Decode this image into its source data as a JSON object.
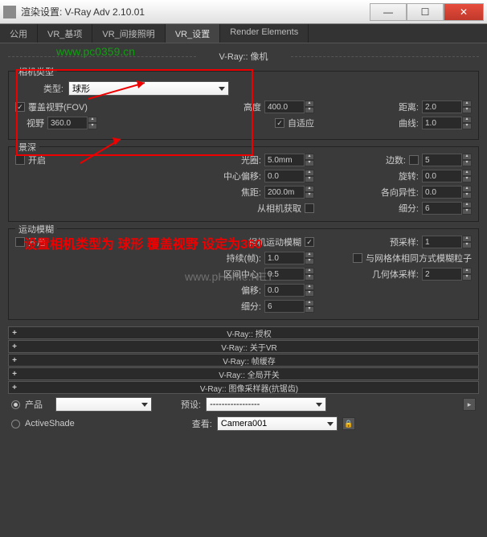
{
  "title": "渲染设置: V-Ray Adv 2.10.01",
  "tabs": [
    "公用",
    "VR_基项",
    "VR_间接照明",
    "VR_设置",
    "Render Elements"
  ],
  "mainSection": "V-Ray:: 像机",
  "cameraType": {
    "legend": "相机类型",
    "typeLabel": "类型:",
    "typeValue": "球形",
    "overrideFov": "覆盖视野(FOV)",
    "overrideFovChecked": "✓",
    "fovLabel": "视野",
    "fovValue": "360.0",
    "heightLabel": "高度",
    "heightValue": "400.0",
    "adaptiveLabel": "自适应",
    "adaptiveChecked": "✓",
    "distLabel": "距离:",
    "distValue": "2.0",
    "curveLabel": "曲线:",
    "curveValue": "1.0"
  },
  "dof": {
    "legend": "景深",
    "enable": "开启",
    "apertureLabel": "光圈:",
    "apertureValue": "5.0mm",
    "bladesLabel": "边数:",
    "bladesValue": "5",
    "centerBiasLabel": "中心偏移:",
    "centerBiasValue": "0.0",
    "rotLabel": "旋转:",
    "rotValue": "0.0",
    "focalLabel": "焦距:",
    "focalValue": "200.0m",
    "anisLabel": "各向异性:",
    "anisValue": "0.0",
    "fromCamLabel": "从相机获取",
    "subdivLabel": "细分:",
    "subdivValue": "6"
  },
  "motion": {
    "legend": "运动模糊",
    "enable": "开启",
    "camBlurLabel": "相机运动模糊",
    "camBlurChecked": "✓",
    "presampLabel": "预采样:",
    "presampValue": "1",
    "durationLabel": "持续(帧):",
    "durationValue": "1.0",
    "meshLabel": "与网格体相同方式模糊粒子",
    "intervalLabel": "区间中心:",
    "intervalValue": "0.5",
    "geoSampLabel": "几何体采样:",
    "geoSampValue": "2",
    "biasLabel": "偏移:",
    "biasValue": "0.0",
    "subdivLabel": "细分:",
    "subdivValue": "6"
  },
  "collapse": [
    "V-Ray:: 授权",
    "V-Ray:: 关于VR",
    "V-Ray:: 帧缓存",
    "V-Ray:: 全局开关",
    "V-Ray:: 图像采样器(抗锯齿)"
  ],
  "footer": {
    "prodLabel": "产品",
    "presetLabel": "预设:",
    "presetValue": "-----------------",
    "activeShadeLabel": "ActiveShade",
    "viewLabel": "查看:",
    "viewValue": "Camera001"
  },
  "annotation": "设置相机类型为 球形 覆盖视野 设定为360",
  "watermark1": "www.pc0359.cn",
  "watermark2": "www.pHome.NET"
}
